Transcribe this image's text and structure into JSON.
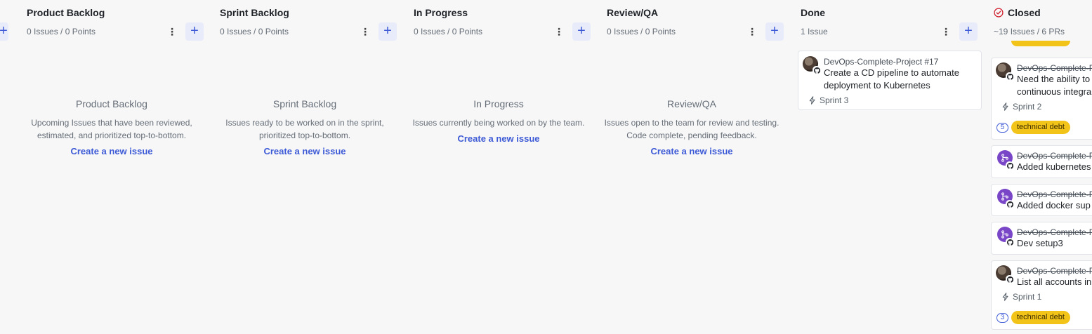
{
  "columns": [
    {
      "title": "Product Backlog",
      "count": "0 Issues / 0 Points",
      "empty_title": "Product Backlog",
      "empty_desc": "Upcoming Issues that have been reviewed, estimated, and prioritized top-to-bottom.",
      "empty_link": "Create a new issue"
    },
    {
      "title": "Sprint Backlog",
      "count": "0 Issues / 0 Points",
      "empty_title": "Sprint Backlog",
      "empty_desc": "Issues ready to be worked on in the sprint, prioritized top-to-bottom.",
      "empty_link": "Create a new issue"
    },
    {
      "title": "In Progress",
      "count": "0 Issues / 0 Points",
      "empty_title": "In Progress",
      "empty_desc": "Issues currently being worked on by the team.",
      "empty_link": "Create a new issue"
    },
    {
      "title": "Review/QA",
      "count": "0 Issues / 0 Points",
      "empty_title": "Review/QA",
      "empty_desc": "Issues open to the team for review and testing. Code complete, pending feedback.",
      "empty_link": "Create a new issue"
    },
    {
      "title": "Done",
      "count": "1 Issue",
      "cards": [
        {
          "repo": "DevOps-Complete-Project #17",
          "title_line1": "Create a CD pipeline to automate",
          "title_line2": "deployment to Kubernetes",
          "sprint": "Sprint 3"
        }
      ]
    },
    {
      "title": "Closed",
      "count": "~19 Issues / 6 PRs",
      "cards": [
        {
          "repo": "DevOps-Complete-P",
          "title_line1": "Need the ability to",
          "title_line2": "continuous integra",
          "sprint": "Sprint 2",
          "estimate": "5",
          "label": "technical debt"
        },
        {
          "repo": "DevOps-Complete-P",
          "title_line1": "Added kubernetes"
        },
        {
          "repo": "DevOps-Complete-P",
          "title_line1": "Added docker sup"
        },
        {
          "repo": "DevOps-Complete-P",
          "title_line1": "Dev setup3"
        },
        {
          "repo": "DevOps-Complete-P",
          "title_line1": "List all accounts in",
          "sprint": "Sprint 1",
          "estimate": "3",
          "label": "technical debt"
        }
      ]
    }
  ],
  "icons": {
    "add": "+",
    "more": "⋮",
    "pr": "pull-request-icon",
    "sprint": "lightning-icon",
    "closed": "check-circle-icon"
  },
  "colors": {
    "accent": "#3d5ad6",
    "label_yellow": "#f2c318",
    "closed_red": "#cf222e",
    "pr_purple": "#7a46c8"
  }
}
